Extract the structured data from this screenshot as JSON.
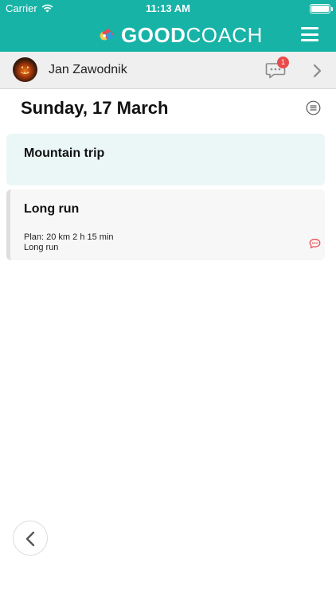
{
  "status_bar": {
    "carrier": "Carrier",
    "time": "11:13 AM",
    "battery_level": 1.0
  },
  "header": {
    "brand_bold": "GOOD",
    "brand_regular": "COACH",
    "menu_icon": "hamburger-menu-icon",
    "color_accent": "#17b3a7"
  },
  "athlete": {
    "name": "Jan Zawodnik",
    "unread_messages": "1",
    "chat_icon": "chat-bubble-icon",
    "next_icon": "chevron-right-icon"
  },
  "day": {
    "title": "Sunday, 17 March",
    "list_icon": "list-menu-icon"
  },
  "cards": [
    {
      "title": "Mountain trip",
      "background": "#ebf7f6"
    },
    {
      "title": "Long run",
      "plan": "Plan: 20 km 2 h 15 min",
      "subtitle": "Long run",
      "comment_icon": "comment-icon",
      "comment_color": "#e94b4b"
    }
  ],
  "footer": {
    "back_icon": "chevron-left-icon"
  }
}
